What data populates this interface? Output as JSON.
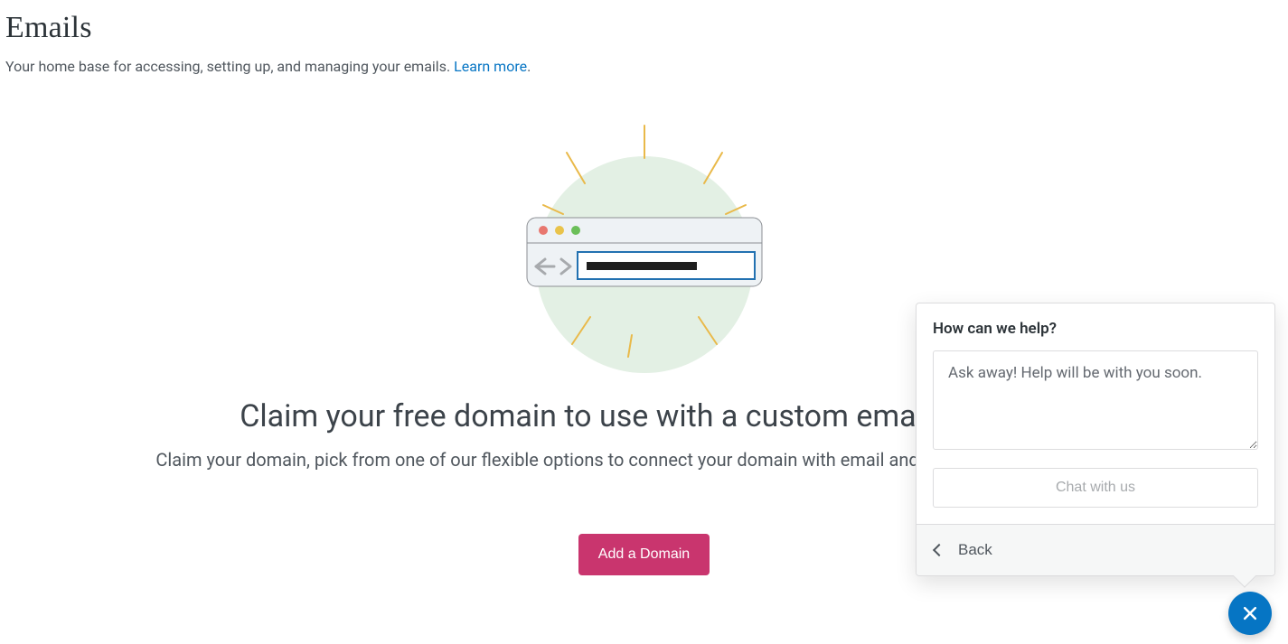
{
  "header": {
    "title": "Emails",
    "subtitle_prefix": "Your home base for accessing, setting up, and managing your emails. ",
    "learn_more_label": "Learn more",
    "subtitle_suffix": "."
  },
  "hero": {
    "headline": "Claim your free domain to use with a custom email address",
    "subtext": "Claim your domain, pick from one of our flexible options to connect your domain with email and start getting emails today.",
    "cta_label": "Add a Domain"
  },
  "help": {
    "title": "How can we help?",
    "placeholder": "Ask away! Help will be with you soon.",
    "chat_label": "Chat with us",
    "back_label": "Back"
  },
  "icons": {
    "close": "close-icon",
    "chevron_left": "chevron-left-icon",
    "browser_illustration": "browser-illustration"
  },
  "colors": {
    "accent": "#c9356e",
    "link": "#0675c4",
    "fab": "#0675c4"
  }
}
